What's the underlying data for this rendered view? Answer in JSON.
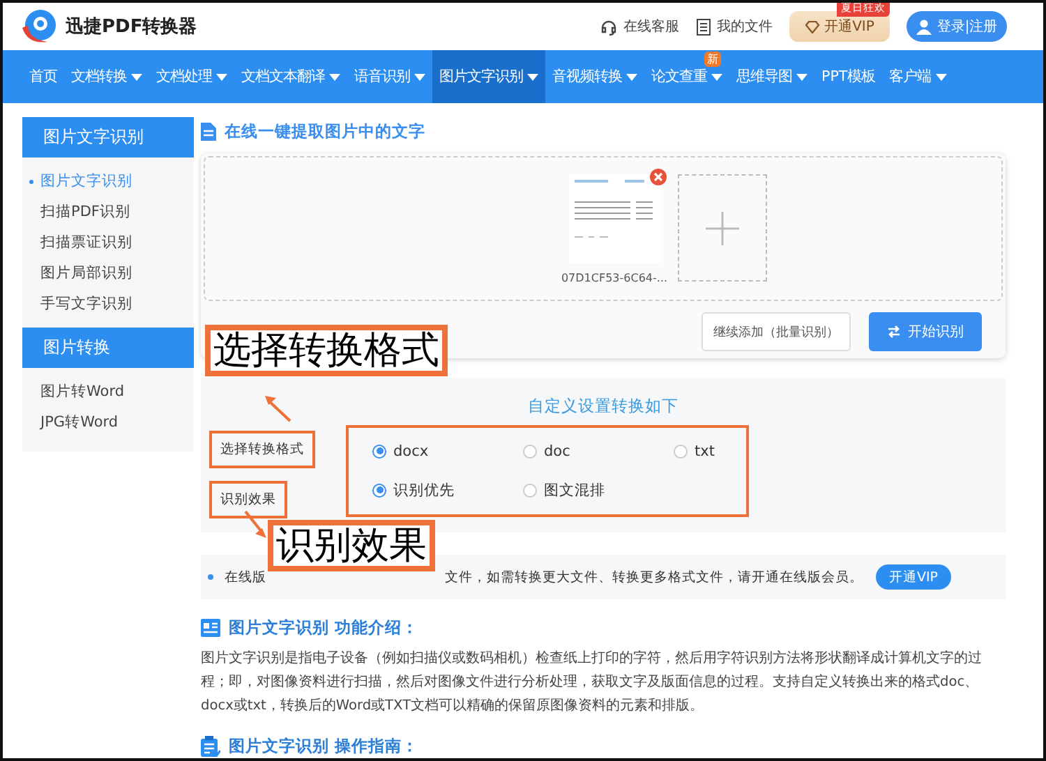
{
  "header": {
    "logo_text": "迅捷PDF转换器",
    "links": [
      {
        "label": "在线客服",
        "kind": "headset"
      },
      {
        "label": "我的文件",
        "kind": "file"
      }
    ],
    "vip_button": {
      "label": "开通VIP",
      "badge": "夏日狂欢"
    },
    "login_button": "登录|注册"
  },
  "nav": [
    {
      "label": "首页",
      "dropdown": false,
      "selected": false
    },
    {
      "label": "文档转换",
      "dropdown": true,
      "selected": false
    },
    {
      "label": "文档处理",
      "dropdown": true,
      "selected": false
    },
    {
      "label": "文档文本翻译",
      "dropdown": true,
      "selected": false
    },
    {
      "label": "语音识别",
      "dropdown": true,
      "selected": false
    },
    {
      "label": "图片文字识别",
      "dropdown": true,
      "selected": true
    },
    {
      "label": "音视频转换",
      "dropdown": true,
      "selected": false
    },
    {
      "label": "论文查重",
      "dropdown": true,
      "selected": false,
      "badge": "新"
    },
    {
      "label": "思维导图",
      "dropdown": true,
      "selected": false
    },
    {
      "label": "PPT模板",
      "dropdown": false,
      "selected": false
    },
    {
      "label": "客户端",
      "dropdown": true,
      "selected": false
    }
  ],
  "sidebar": {
    "groups": [
      {
        "title": "图片文字识别",
        "items": [
          {
            "label": "图片文字识别",
            "selected": true
          },
          {
            "label": "扫描PDF识别",
            "selected": false
          },
          {
            "label": "扫描票证识别",
            "selected": false
          },
          {
            "label": "图片局部识别",
            "selected": false
          },
          {
            "label": "手写文字识别",
            "selected": false
          }
        ]
      },
      {
        "title": "图片转换",
        "items": [
          {
            "label": "图片转Word",
            "selected": false
          },
          {
            "label": "JPG转Word",
            "selected": false
          }
        ]
      }
    ]
  },
  "main": {
    "title": "在线一键提取图片中的文字",
    "upload": {
      "files": [
        {
          "name": "07D1CF53-6C64-..."
        }
      ],
      "add_more_button": "继续添加（批量识别）",
      "start_button": "开始识别"
    },
    "settings": {
      "title": "自定义设置转换如下",
      "rows": [
        {
          "label": "选择转换格式",
          "options": [
            {
              "label": "docx",
              "selected": true
            },
            {
              "label": "doc",
              "selected": false
            },
            {
              "label": "txt",
              "selected": false
            }
          ]
        },
        {
          "label": "识别效果",
          "options": [
            {
              "label": "识别优先",
              "selected": true
            },
            {
              "label": "图文混排",
              "selected": false
            }
          ]
        }
      ]
    },
    "notice": {
      "text_start": "在线版",
      "text_end": "文件，如需转换更大文件、转换更多格式文件，请开通在线版会员。",
      "button": "开通VIP"
    },
    "sections": [
      {
        "kind": "intro",
        "heading": "图片文字识别 功能介绍：",
        "paragraph": "图片文字识别是指电子设备（例如扫描仪或数码相机）检查纸上打印的字符，然后用字符识别方法将形状翻译成计算机文字的过程；即，对图像资料进行扫描，然后对图像文件进行分析处理，获取文字及版面信息的过程。支持自定义转换出来的格式doc、docx或txt，转换后的Word或TXT文档可以精确的保留原图像资料的元素和排版。"
      },
      {
        "kind": "guide",
        "heading": "图片文字识别 操作指南："
      }
    ]
  },
  "annotations": [
    {
      "text": "选择转换格式"
    },
    {
      "text": "识别效果"
    }
  ]
}
